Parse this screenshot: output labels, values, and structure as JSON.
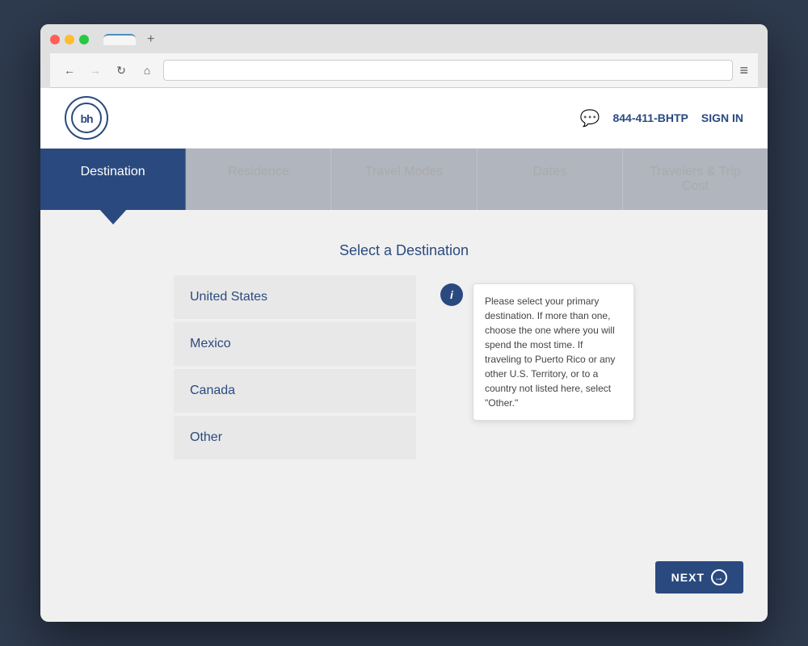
{
  "browser": {
    "tab_label": "",
    "tab_plus": "+",
    "address_value": "",
    "menu_icon": "≡"
  },
  "header": {
    "logo_text": "bh",
    "phone": "844-411-BHTP",
    "sign_in": "SIGN IN"
  },
  "wizard": {
    "steps": [
      {
        "id": "destination",
        "label": "Destination",
        "active": true
      },
      {
        "id": "residence",
        "label": "Residence",
        "active": false
      },
      {
        "id": "travel-modes",
        "label": "Travel Modes",
        "active": false
      },
      {
        "id": "dates",
        "label": "Dates",
        "active": false
      },
      {
        "id": "travelers",
        "label": "Travelers & Trip Cost",
        "active": false
      }
    ]
  },
  "main": {
    "section_title": "Select a Destination",
    "destinations": [
      {
        "id": "us",
        "label": "United States"
      },
      {
        "id": "mexico",
        "label": "Mexico"
      },
      {
        "id": "canada",
        "label": "Canada"
      },
      {
        "id": "other",
        "label": "Other"
      }
    ],
    "tooltip_icon": "i",
    "tooltip_text": "Please select your primary destination. If more than one, choose the one where you will spend the most time. If traveling to Puerto Rico or any other U.S. Territory, or to a country not listed here, select \"Other.\""
  },
  "footer": {
    "next_label": "NEXT",
    "next_arrow": "→"
  }
}
